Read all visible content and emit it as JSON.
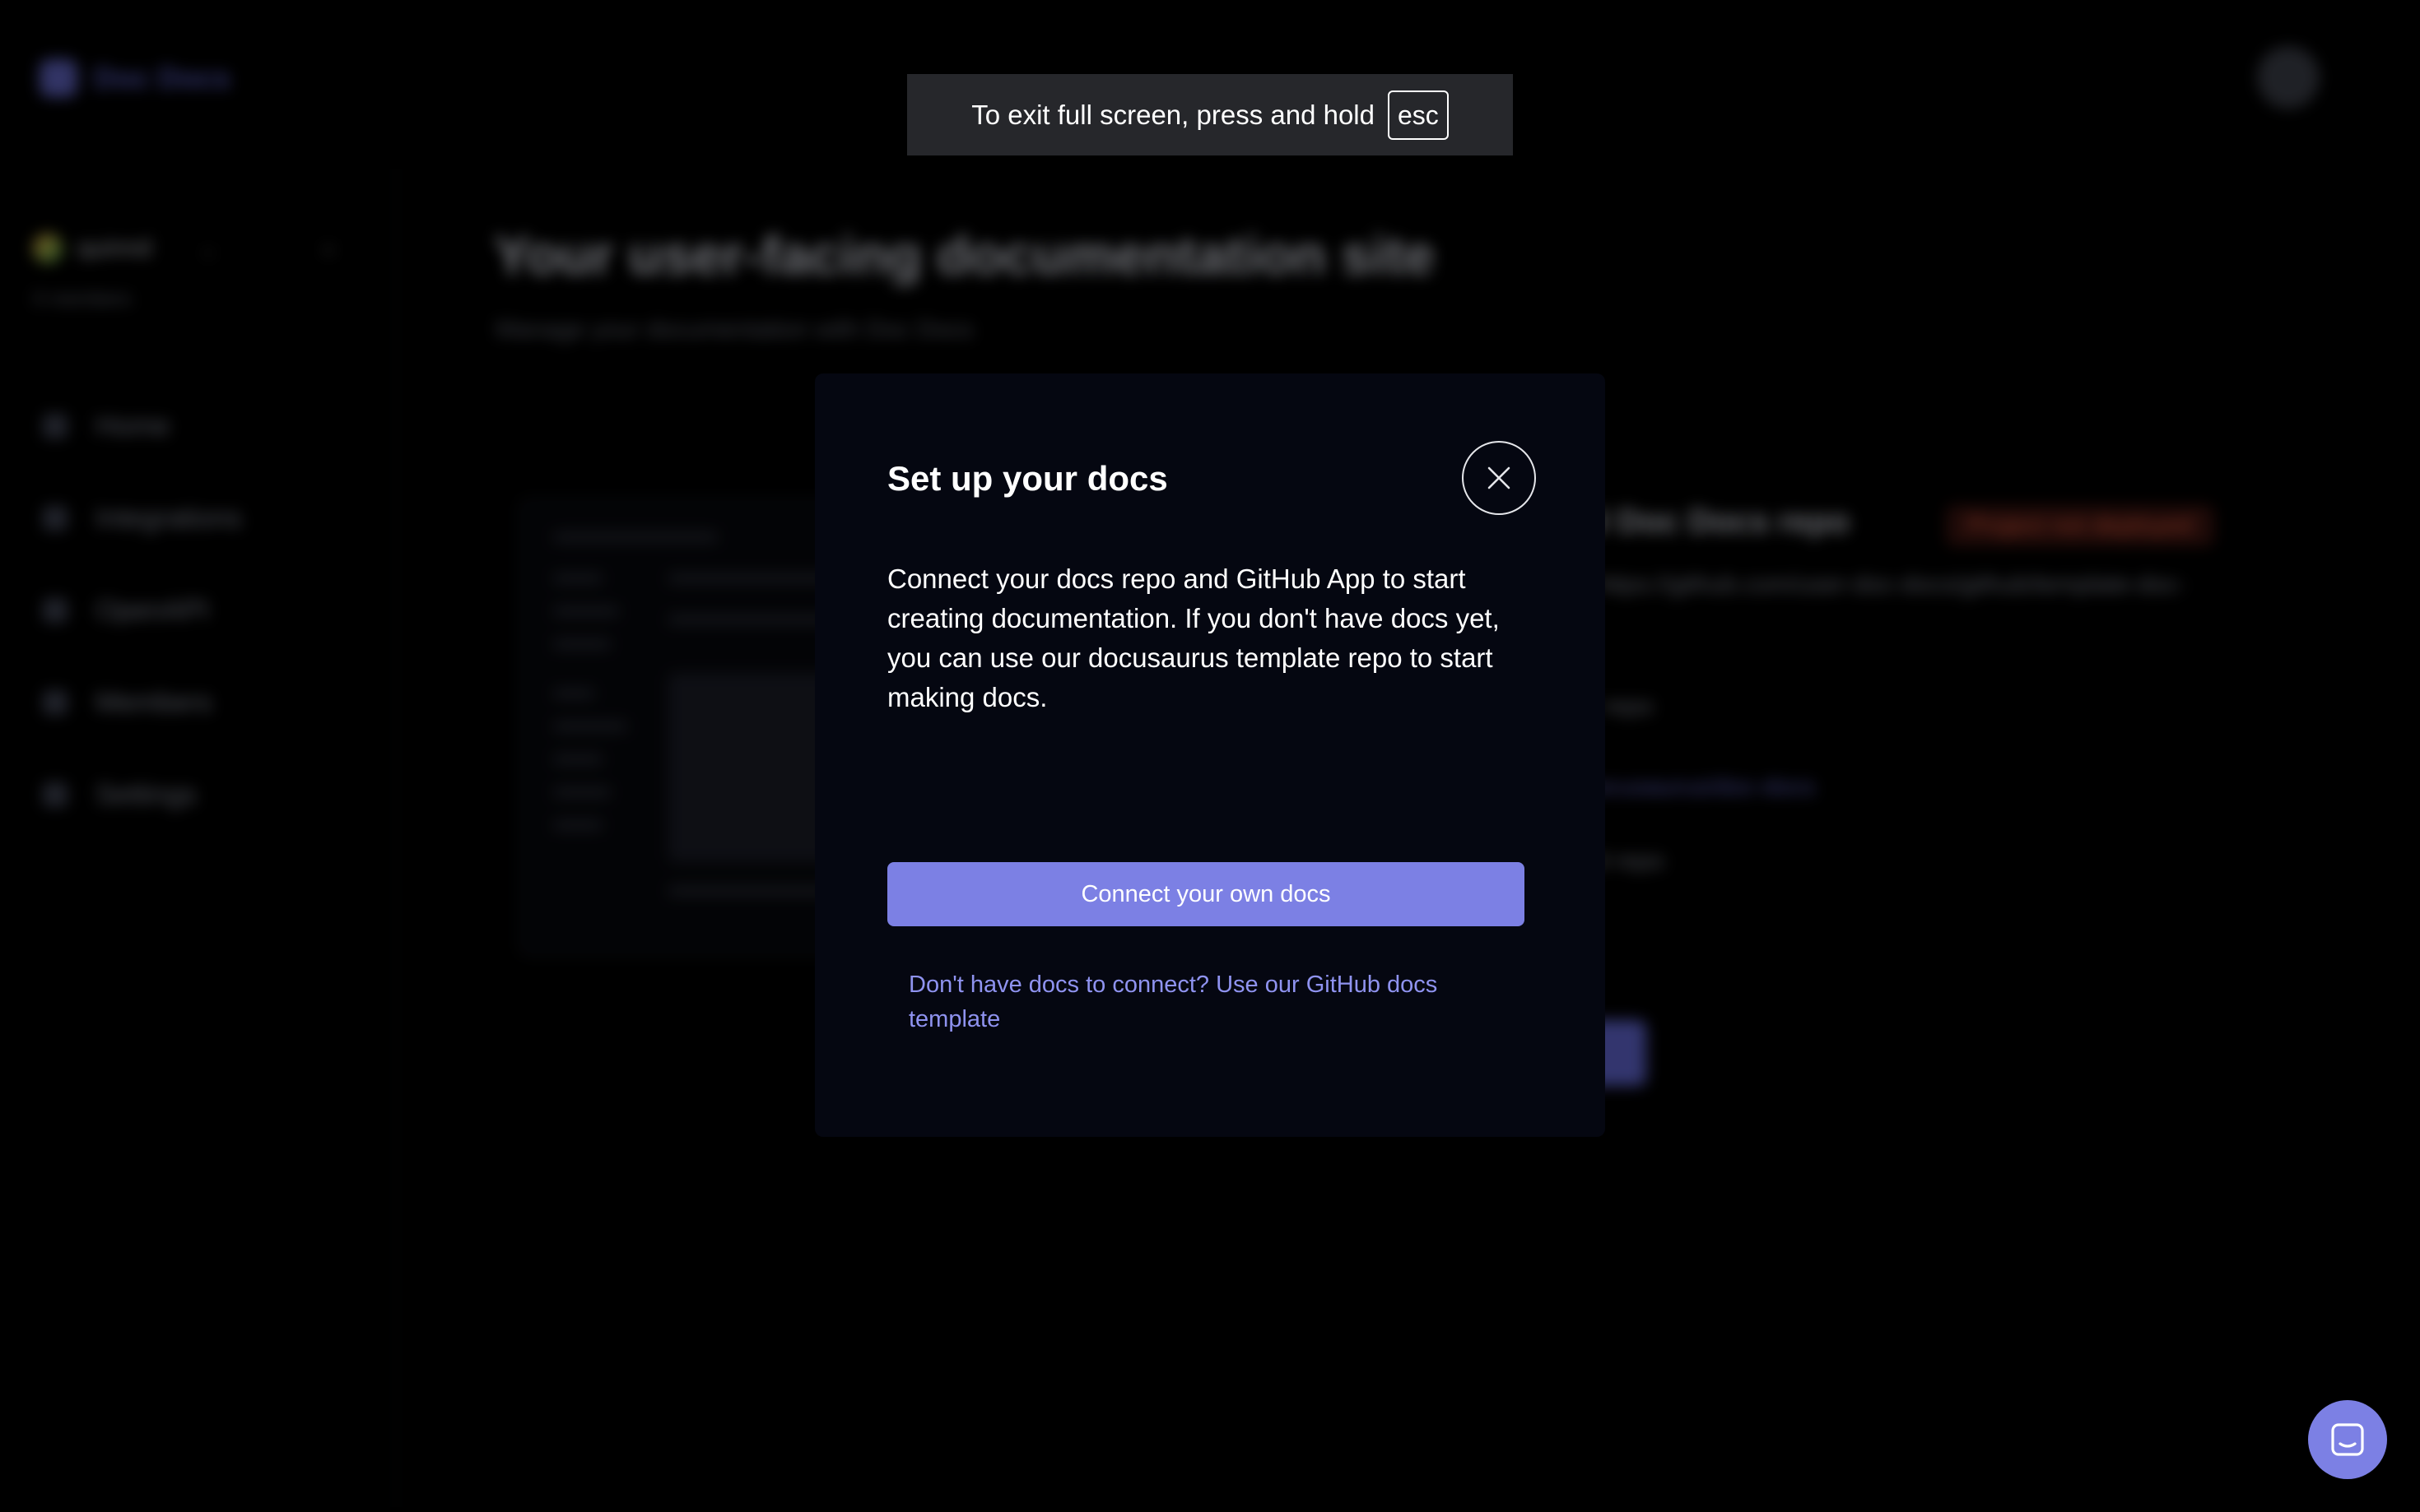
{
  "app": {
    "brand": "Doc Docs",
    "org_name": "quinnd",
    "org_sub": "0 members",
    "nav": [
      "Home",
      "Integrations",
      "OpenAPI",
      "Members",
      "Settings"
    ],
    "main_title": "Your user-facing documentation site",
    "main_subtitle": "Manage your documentation with Doc Docs",
    "card_title": "al Doc Docs repo",
    "card_badge": "Project not deployed",
    "card_desc": "r https://github.com/user-doc-docs/github/template-doc-",
    "card_line_1": "E repo",
    "card_line_2": "docusaurus/doc-docs",
    "card_line_3": "ed repo"
  },
  "fullscreen_notice": {
    "text": "To exit full screen, press and hold",
    "key": "esc"
  },
  "modal": {
    "title": "Set up your docs",
    "body": "Connect your docs repo and GitHub App to start creating documentation. If you don't have docs yet, you can use our docusaurus template repo to start making docs.",
    "primary_button": "Connect your own docs",
    "secondary_link": "Don't have docs to connect? Use our GitHub docs template",
    "close_icon": "close-icon"
  },
  "chat": {
    "icon": "chat-icon",
    "color": "#7c80e4"
  },
  "colors": {
    "accent": "#7c80e4",
    "link": "#8f93f0",
    "modal_bg": "#050711"
  }
}
